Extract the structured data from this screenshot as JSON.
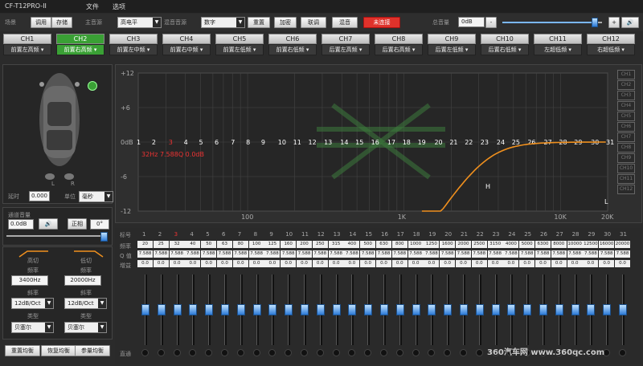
{
  "app": {
    "title": "CF-T12PRO-II",
    "menu": [
      "文件",
      "选项"
    ]
  },
  "toolbar": {
    "scene_label": "场景",
    "call_btn": "调用",
    "save_btn": "存储",
    "main_src_label": "主音源",
    "main_src_value": "高电平",
    "mix_src_label": "混音音源",
    "mix_src_value": "数字",
    "reset_btn": "重置",
    "encrypt_btn": "加密",
    "link_btn": "联调",
    "mix_btn": "混音",
    "status_btn": "未连接",
    "total_vol_label": "总音量",
    "total_vol_value": "0dB",
    "minus": "-",
    "plus": "+",
    "master_volume_level": 0.92
  },
  "channels": [
    {
      "name": "CH1",
      "role": "前置左高频"
    },
    {
      "name": "CH2",
      "role": "前置右高频"
    },
    {
      "name": "CH3",
      "role": "前置左中频"
    },
    {
      "name": "CH4",
      "role": "前置右中频"
    },
    {
      "name": "CH5",
      "role": "前置左低频"
    },
    {
      "name": "CH6",
      "role": "前置右低频"
    },
    {
      "name": "CH7",
      "role": "后置左高频"
    },
    {
      "name": "CH8",
      "role": "后置右高频"
    },
    {
      "name": "CH9",
      "role": "后置左低频"
    },
    {
      "name": "CH10",
      "role": "后置右低频"
    },
    {
      "name": "CH11",
      "role": "左超低频"
    },
    {
      "name": "CH12",
      "role": "右超低频"
    }
  ],
  "left": {
    "delay_label": "延时",
    "delay_value": "0.000",
    "unit_label": "单位",
    "unit_value": "毫秒",
    "speaker_l": "L",
    "speaker_r": "R",
    "ch_gain_label": "通道音量",
    "ch_gain_value": "0.0dB",
    "phase_btn": "正相",
    "phase_value": "0°",
    "highpass_label": "高切",
    "lowpass_label": "低切",
    "freq_label": "频率",
    "hp_freq": "3400Hz",
    "lp_freq": "20000Hz",
    "slope_label": "斜率",
    "hp_slope": "12dB/Oct",
    "lp_slope": "12dB/Oct",
    "type_label": "类型",
    "hp_type": "贝塞尔",
    "lp_type": "贝塞尔",
    "reset_eq": "重置均衡",
    "restore_eq": "恢复均衡",
    "bypass_eq": "参量均衡"
  },
  "graph": {
    "y_labels": [
      "+12",
      "+6",
      "0dB",
      "-6",
      "-12"
    ],
    "x_labels": [
      "100",
      "1K",
      "10K",
      "20K"
    ],
    "band_points": [
      "1",
      "2",
      "3",
      "4",
      "5",
      "6",
      "7",
      "8",
      "9",
      "10",
      "11",
      "12",
      "13",
      "14",
      "15",
      "16",
      "17",
      "18",
      "19",
      "20",
      "21",
      "22",
      "23",
      "24",
      "25",
      "26",
      "27",
      "28",
      "29",
      "30",
      "31"
    ],
    "sel_band_small": "频",
    "sel_band_small2": "频",
    "readout": "32Hz 7.588Q 0.0dB",
    "marker_h": "H",
    "marker_l": "L",
    "side_channels": [
      "CH1",
      "CH2",
      "CH3",
      "CH4",
      "CH5",
      "CH6",
      "CH7",
      "CH8",
      "CH9",
      "CH10",
      "CH11",
      "CH12"
    ]
  },
  "table": {
    "row_labels": [
      "标号",
      "频率",
      "Q 值",
      "增益"
    ],
    "index": [
      "1",
      "2",
      "3",
      "4",
      "5",
      "6",
      "7",
      "8",
      "9",
      "10",
      "11",
      "12",
      "13",
      "14",
      "15",
      "16",
      "17",
      "18",
      "19",
      "20",
      "21",
      "22",
      "23",
      "24",
      "25",
      "26",
      "27",
      "28",
      "29",
      "30",
      "31"
    ],
    "freq": [
      "20",
      "25",
      "32",
      "40",
      "50",
      "63",
      "80",
      "100",
      "125",
      "160",
      "200",
      "250",
      "315",
      "400",
      "500",
      "630",
      "800",
      "1000",
      "1250",
      "1600",
      "2000",
      "2500",
      "3150",
      "4000",
      "5000",
      "6300",
      "8000",
      "10000",
      "12500",
      "16000",
      "20000"
    ],
    "q": [
      "7.588",
      "7.588",
      "7.588",
      "7.588",
      "7.588",
      "7.588",
      "7.588",
      "7.588",
      "7.588",
      "7.588",
      "7.588",
      "7.588",
      "7.588",
      "7.588",
      "7.588",
      "7.588",
      "7.588",
      "7.588",
      "7.588",
      "7.588",
      "7.588",
      "7.588",
      "7.588",
      "7.588",
      "7.588",
      "7.588",
      "7.588",
      "7.588",
      "7.588",
      "7.588",
      "7.588"
    ],
    "gain": [
      "0.0",
      "0.0",
      "0.0",
      "0.0",
      "0.0",
      "0.0",
      "0.0",
      "0.0",
      "0.0",
      "0.0",
      "0.0",
      "0.0",
      "0.0",
      "0.0",
      "0.0",
      "0.0",
      "0.0",
      "0.0",
      "0.0",
      "0.0",
      "0.0",
      "0.0",
      "0.0",
      "0.0",
      "0.0",
      "0.0",
      "0.0",
      "0.0",
      "0.0",
      "0.0",
      "0.0"
    ],
    "bypass_label": "直通"
  },
  "watermark": "360汽车网 www.360qc.com",
  "colors": {
    "accent_green": "#3aa035",
    "status_red": "#e0322b",
    "curve_orange": "#f0901e",
    "knob_blue": "#2b79d6"
  }
}
